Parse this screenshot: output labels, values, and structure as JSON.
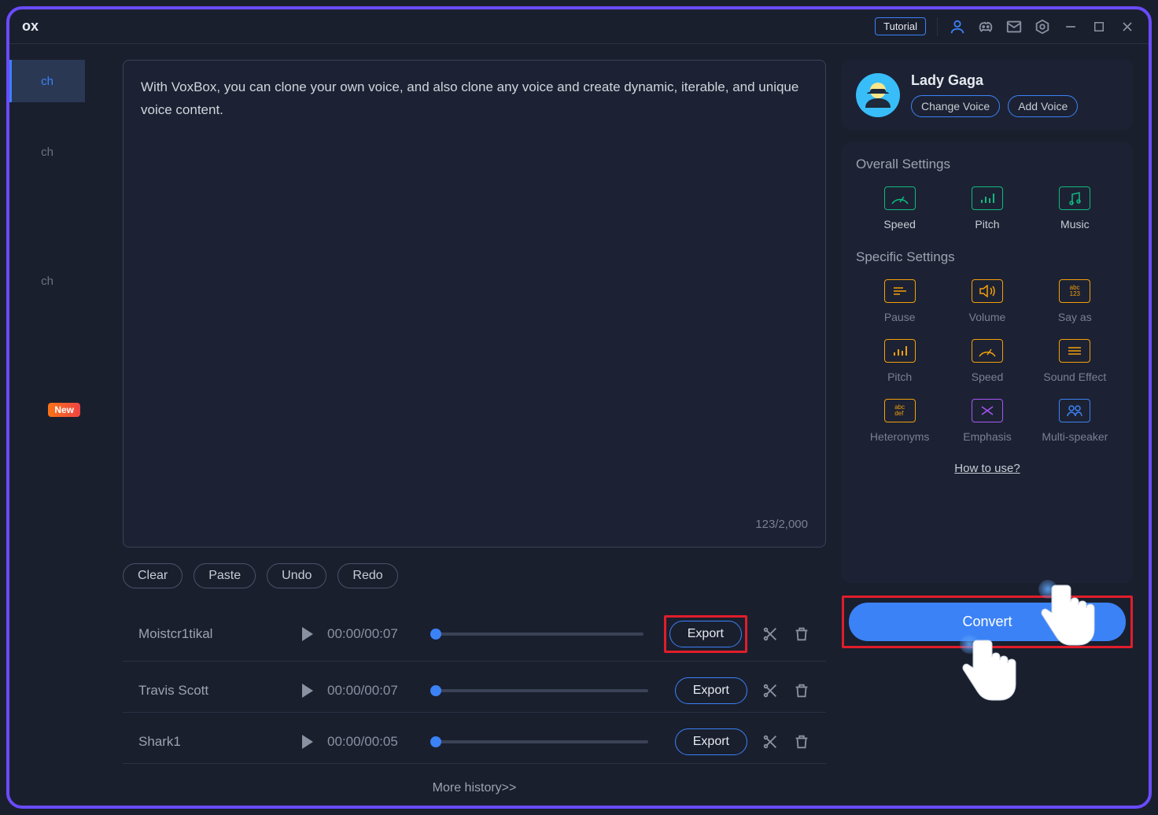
{
  "titlebar": {
    "app_fragment": "ox",
    "tutorial_label": "Tutorial"
  },
  "sidebar": {
    "items": [
      {
        "label": "ch",
        "active": true
      },
      {
        "label": "ch"
      },
      {
        "label": "ch"
      }
    ],
    "new_label": "New"
  },
  "editor": {
    "text": "With VoxBox, you can clone your own voice, and also clone any voice and create dynamic, iterable, and unique voice content.",
    "char_count": "123/2,000",
    "buttons": {
      "clear": "Clear",
      "paste": "Paste",
      "undo": "Undo",
      "redo": "Redo"
    }
  },
  "voice": {
    "name": "Lady Gaga",
    "change_label": "Change Voice",
    "add_label": "Add Voice"
  },
  "settings": {
    "overall_title": "Overall Settings",
    "overall": [
      {
        "label": "Speed"
      },
      {
        "label": "Pitch"
      },
      {
        "label": "Music"
      }
    ],
    "specific_title": "Specific Settings",
    "specific": [
      {
        "label": "Pause"
      },
      {
        "label": "Volume"
      },
      {
        "label": "Say as"
      },
      {
        "label": "Pitch"
      },
      {
        "label": "Speed"
      },
      {
        "label": "Sound Effect"
      },
      {
        "label": "Heteronyms"
      },
      {
        "label": "Emphasis"
      },
      {
        "label": "Multi-speaker"
      }
    ],
    "how_to": "How to use?"
  },
  "convert_label": "Convert",
  "history": {
    "rows": [
      {
        "name": "Moistcr1tikal",
        "time": "00:00/00:07",
        "export": "Export"
      },
      {
        "name": "Travis Scott",
        "time": "00:00/00:07",
        "export": "Export"
      },
      {
        "name": "Shark1",
        "time": "00:00/00:05",
        "export": "Export"
      }
    ],
    "more": "More history>>"
  }
}
